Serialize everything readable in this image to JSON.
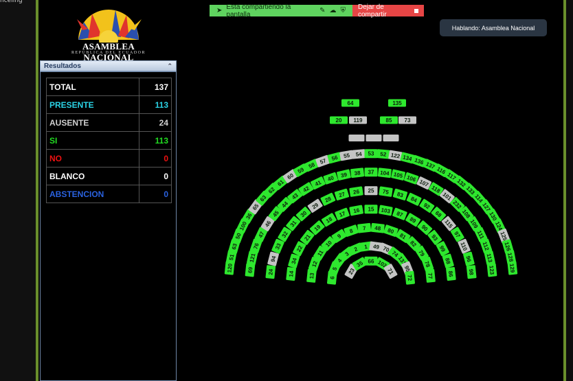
{
  "corner_text": "nceling",
  "share_bar": {
    "sharing_text": "Está compartiendo la pantalla",
    "stop_label": "Dejar de compartir"
  },
  "speaking": "Hablando: Asamblea Nacional",
  "logo": {
    "name": "ASAMBLEA NACIONAL",
    "subtitle": "REPÚBLICA DEL ECUADOR"
  },
  "results": {
    "title": "Resultados",
    "rows": [
      {
        "label": "TOTAL",
        "value": "137",
        "label_color": "#ffffff",
        "value_color": "#ffffff"
      },
      {
        "label": "PRESENTE",
        "value": "113",
        "label_color": "#2bd3e6",
        "value_color": "#2bd3e6"
      },
      {
        "label": "AUSENTE",
        "value": "24",
        "label_color": "#d0d0d0",
        "value_color": "#d0d0d0"
      },
      {
        "label": "SI",
        "value": "113",
        "label_color": "#22dd22",
        "value_color": "#22dd22"
      },
      {
        "label": "NO",
        "value": "0",
        "label_color": "#ee1111",
        "value_color": "#ee1111"
      },
      {
        "label": "BLANCO",
        "value": "0",
        "label_color": "#ffffff",
        "value_color": "#ffffff"
      },
      {
        "label": "ABSTENCION",
        "value": "0",
        "label_color": "#2a62e0",
        "value_color": "#2a62e0"
      }
    ]
  },
  "colors": {
    "present": "#2ee82e",
    "absent": "#c4c4c4",
    "accent_border": "#6a8f2c"
  },
  "chamber": {
    "front_seats": [
      {
        "num": "64",
        "status": "present"
      },
      {
        "num": "135",
        "status": "present"
      },
      {
        "num": "20",
        "status": "present"
      },
      {
        "num": "119",
        "status": "absent"
      },
      {
        "num": "85",
        "status": "present"
      },
      {
        "num": "73",
        "status": "absent"
      }
    ],
    "podium": [
      "",
      "",
      ""
    ],
    "rows": [
      {
        "seats": [
          {
            "num": "120",
            "status": "present"
          },
          {
            "num": "51",
            "status": "present"
          },
          {
            "num": "63",
            "status": "present"
          },
          {
            "num": "50",
            "status": "present"
          },
          {
            "num": "100",
            "status": "present"
          },
          {
            "num": "36",
            "status": "present"
          },
          {
            "num": "65",
            "status": "absent"
          },
          {
            "num": "63",
            "status": "present"
          },
          {
            "num": "62",
            "status": "present"
          },
          {
            "num": "61",
            "status": "present"
          },
          {
            "num": "60",
            "status": "absent"
          },
          {
            "num": "59",
            "status": "present"
          },
          {
            "num": "58",
            "status": "present"
          },
          {
            "num": "57",
            "status": "absent"
          },
          {
            "num": "56",
            "status": "present"
          },
          {
            "num": "55",
            "status": "absent"
          },
          {
            "num": "54",
            "status": "absent"
          },
          {
            "num": "53",
            "status": "present"
          },
          {
            "num": "52",
            "status": "present"
          },
          {
            "num": "122",
            "status": "absent"
          },
          {
            "num": "134",
            "status": "present"
          },
          {
            "num": "136",
            "status": "present"
          },
          {
            "num": "137",
            "status": "present"
          },
          {
            "num": "116",
            "status": "present"
          },
          {
            "num": "117",
            "status": "present"
          },
          {
            "num": "132",
            "status": "present"
          },
          {
            "num": "133",
            "status": "present"
          },
          {
            "num": "114",
            "status": "present"
          },
          {
            "num": "127",
            "status": "present"
          },
          {
            "num": "130",
            "status": "present"
          },
          {
            "num": "124",
            "status": "present"
          },
          {
            "num": "125",
            "status": "absent"
          },
          {
            "num": "126",
            "status": "present"
          },
          {
            "num": "128",
            "status": "present"
          },
          {
            "num": "129",
            "status": "present"
          }
        ]
      },
      {
        "seats": [
          {
            "num": "69",
            "status": "present"
          },
          {
            "num": "121",
            "status": "present"
          },
          {
            "num": "76",
            "status": "present"
          },
          {
            "num": "47",
            "status": "present"
          },
          {
            "num": "46",
            "status": "absent"
          },
          {
            "num": "45",
            "status": "present"
          },
          {
            "num": "44",
            "status": "present"
          },
          {
            "num": "43",
            "status": "present"
          },
          {
            "num": "42",
            "status": "present"
          },
          {
            "num": "41",
            "status": "present"
          },
          {
            "num": "40",
            "status": "present"
          },
          {
            "num": "39",
            "status": "present"
          },
          {
            "num": "38",
            "status": "present"
          },
          {
            "num": "37",
            "status": "present"
          },
          {
            "num": "104",
            "status": "present"
          },
          {
            "num": "105",
            "status": "present"
          },
          {
            "num": "106",
            "status": "present"
          },
          {
            "num": "107",
            "status": "absent"
          },
          {
            "num": "118",
            "status": "present"
          },
          {
            "num": "101",
            "status": "absent"
          },
          {
            "num": "232",
            "status": "present"
          },
          {
            "num": "108",
            "status": "present"
          },
          {
            "num": "109",
            "status": "present"
          },
          {
            "num": "111",
            "status": "present"
          },
          {
            "num": "112",
            "status": "present"
          },
          {
            "num": "113",
            "status": "present"
          },
          {
            "num": "123",
            "status": "present"
          }
        ]
      },
      {
        "seats": [
          {
            "num": "24",
            "status": "present"
          },
          {
            "num": "94",
            "status": "absent"
          },
          {
            "num": "33",
            "status": "present"
          },
          {
            "num": "32",
            "status": "present"
          },
          {
            "num": "31",
            "status": "present"
          },
          {
            "num": "30",
            "status": "present"
          },
          {
            "num": "29",
            "status": "absent"
          },
          {
            "num": "28",
            "status": "present"
          },
          {
            "num": "27",
            "status": "present"
          },
          {
            "num": "26",
            "status": "present"
          },
          {
            "num": "25",
            "status": "absent"
          },
          {
            "num": "75",
            "status": "present"
          },
          {
            "num": "83",
            "status": "present"
          },
          {
            "num": "84",
            "status": "present"
          },
          {
            "num": "92",
            "status": "present"
          },
          {
            "num": "68",
            "status": "present"
          },
          {
            "num": "115",
            "status": "absent"
          },
          {
            "num": "97",
            "status": "present"
          },
          {
            "num": "110",
            "status": "absent"
          },
          {
            "num": "96",
            "status": "present"
          },
          {
            "num": "98",
            "status": "present"
          }
        ]
      },
      {
        "seats": [
          {
            "num": "14",
            "status": "present"
          },
          {
            "num": "34",
            "status": "present"
          },
          {
            "num": "22",
            "status": "present"
          },
          {
            "num": "21",
            "status": "present"
          },
          {
            "num": "19",
            "status": "present"
          },
          {
            "num": "18",
            "status": "present"
          },
          {
            "num": "17",
            "status": "present"
          },
          {
            "num": "16",
            "status": "present"
          },
          {
            "num": "15",
            "status": "present"
          },
          {
            "num": "103",
            "status": "present"
          },
          {
            "num": "87",
            "status": "present"
          },
          {
            "num": "89",
            "status": "present"
          },
          {
            "num": "90",
            "status": "present"
          },
          {
            "num": "93",
            "status": "present"
          },
          {
            "num": "99",
            "status": "present"
          },
          {
            "num": "88",
            "status": "present"
          },
          {
            "num": "86",
            "status": "present"
          }
        ]
      },
      {
        "seats": [
          {
            "num": "13",
            "status": "present"
          },
          {
            "num": "12",
            "status": "present"
          },
          {
            "num": "11",
            "status": "present"
          },
          {
            "num": "10",
            "status": "present"
          },
          {
            "num": "9",
            "status": "present"
          },
          {
            "num": "8",
            "status": "present"
          },
          {
            "num": "7",
            "status": "present"
          },
          {
            "num": "48",
            "status": "present"
          },
          {
            "num": "80",
            "status": "present"
          },
          {
            "num": "81",
            "status": "present"
          },
          {
            "num": "82",
            "status": "present"
          },
          {
            "num": "79",
            "status": "present"
          },
          {
            "num": "78",
            "status": "present"
          },
          {
            "num": "77",
            "status": "present"
          }
        ]
      },
      {
        "seats": [
          {
            "num": "6",
            "status": "present"
          },
          {
            "num": "5",
            "status": "present"
          },
          {
            "num": "4",
            "status": "present"
          },
          {
            "num": "3",
            "status": "present"
          },
          {
            "num": "2",
            "status": "present"
          },
          {
            "num": "1",
            "status": "present"
          },
          {
            "num": "49",
            "status": "absent"
          },
          {
            "num": "70",
            "status": "absent"
          },
          {
            "num": "74",
            "status": "present"
          },
          {
            "num": "131",
            "status": "present"
          },
          {
            "num": "95",
            "status": "absent"
          },
          {
            "num": "72",
            "status": "present"
          }
        ]
      },
      {
        "seats": [
          {
            "num": "23",
            "status": "absent"
          },
          {
            "num": "35",
            "status": "present"
          },
          {
            "num": "66",
            "status": "present"
          },
          {
            "num": "102",
            "status": "present"
          },
          {
            "num": "71",
            "status": "absent"
          }
        ]
      }
    ]
  }
}
